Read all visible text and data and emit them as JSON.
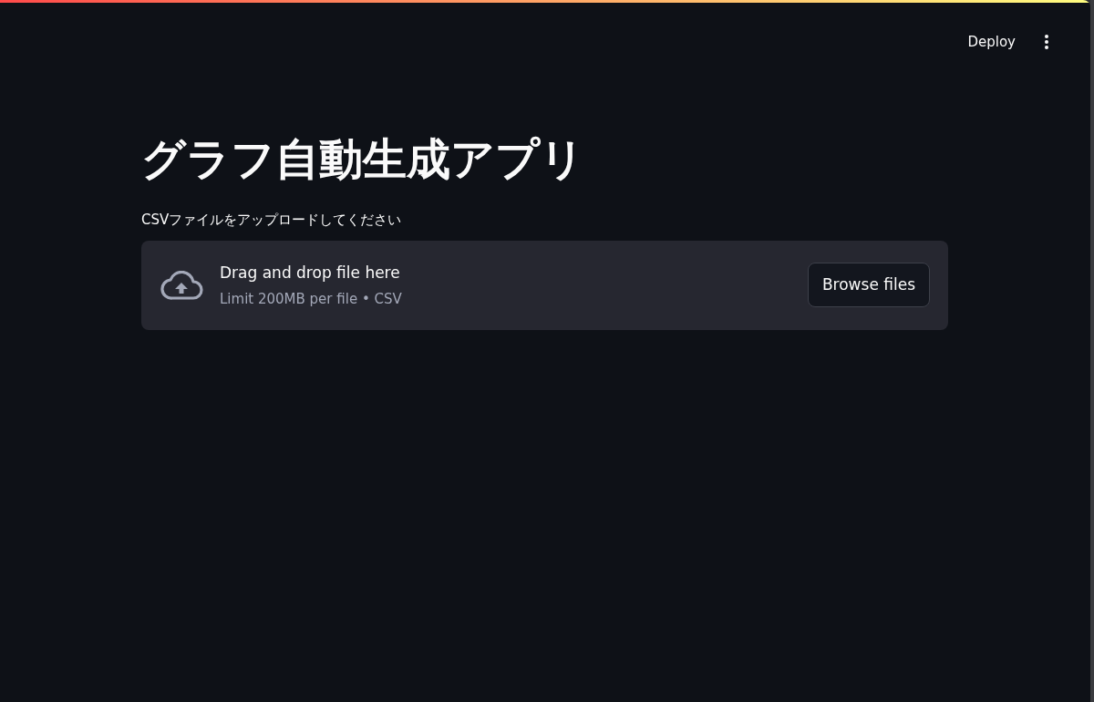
{
  "header": {
    "deploy_label": "Deploy"
  },
  "title": "グラフ自動生成アプリ",
  "uploader": {
    "label": "CSVファイルをアップロードしてください",
    "instructions": "Drag and drop file here",
    "limit_note": "Limit 200MB per file • CSV",
    "button": "Browse files"
  }
}
